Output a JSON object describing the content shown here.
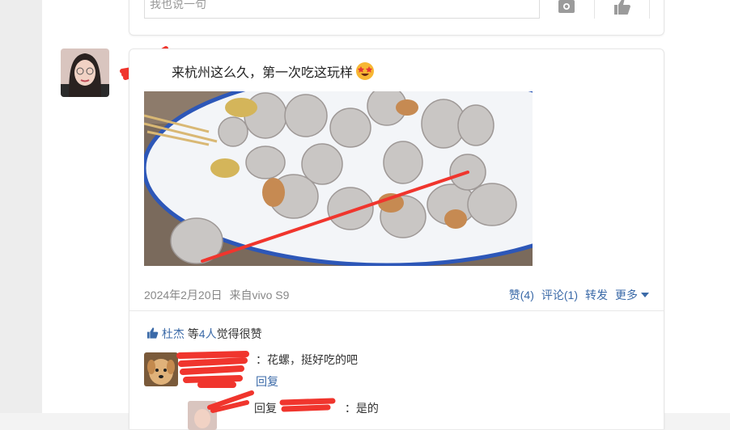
{
  "comment_box": {
    "placeholder": "我也说一句"
  },
  "post": {
    "text": "来杭州这么久，第一次吃这玩样",
    "emoji": "star-struck-emoji",
    "date": "2024年2月20日",
    "source": "来自vivo S9",
    "actions": {
      "like": "赞(4)",
      "comment": "评论(1)",
      "repost": "转发",
      "more": "更多"
    }
  },
  "likes": {
    "name": "杜杰",
    "middle": "等",
    "count": "4人",
    "suffix": "觉得很赞"
  },
  "comments": [
    {
      "text": "：花螺，挺好吃的吧",
      "reply": "回复"
    },
    {
      "reply_prefix": "回复",
      "text": "：是的"
    }
  ],
  "colors": {
    "link": "#3b6aa8",
    "redact": "#f0352d"
  }
}
